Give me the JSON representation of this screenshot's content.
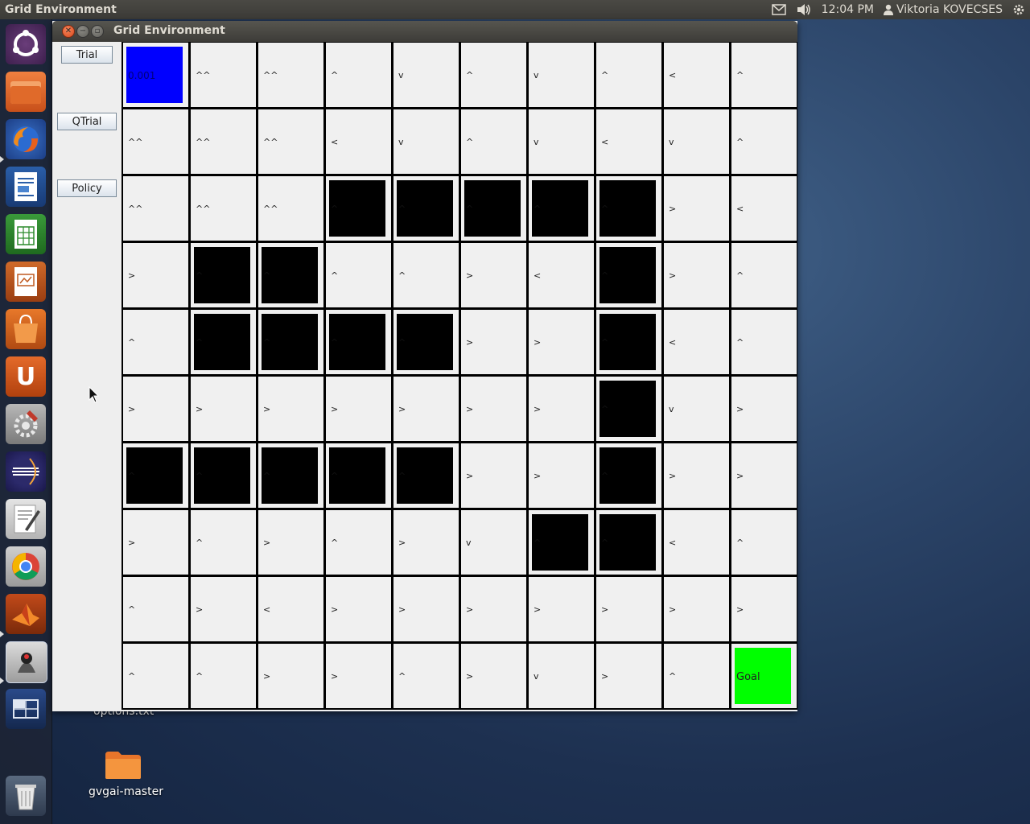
{
  "top_panel": {
    "app_title": "Grid Environment",
    "time": "12:04 PM",
    "user": "Viktoria KOVECSES"
  },
  "desktop": {
    "items": [
      {
        "label": "options.txt"
      },
      {
        "label": "gvgai-master"
      }
    ]
  },
  "launcher": {
    "items": [
      "ubuntu-dash-icon",
      "files-icon",
      "firefox-icon",
      "writer-icon",
      "calc-icon",
      "impress-icon",
      "software-center-icon",
      "ubuntu-one-icon",
      "system-settings-icon",
      "eclipse-icon",
      "text-editor-icon",
      "chrome-icon",
      "matlab-icon",
      "java-icon",
      "workspace-switcher-icon",
      "trash-icon"
    ]
  },
  "window": {
    "title": "Grid Environment",
    "buttons": {
      "trial": "Trial",
      "qtrial": "QTrial",
      "policy": "Policy"
    },
    "grid": {
      "rows": [
        [
          {
            "t": "agent",
            "v": "0.001"
          },
          {
            "t": "n",
            "v": "^^"
          },
          {
            "t": "n",
            "v": "^^"
          },
          {
            "t": "n",
            "v": "^"
          },
          {
            "t": "n",
            "v": "v"
          },
          {
            "t": "n",
            "v": "^"
          },
          {
            "t": "n",
            "v": "v"
          },
          {
            "t": "n",
            "v": "^"
          },
          {
            "t": "n",
            "v": "<"
          },
          {
            "t": "n",
            "v": "^"
          }
        ],
        [
          {
            "t": "n",
            "v": "^^"
          },
          {
            "t": "n",
            "v": "^^"
          },
          {
            "t": "n",
            "v": "^^"
          },
          {
            "t": "n",
            "v": "<"
          },
          {
            "t": "n",
            "v": "v"
          },
          {
            "t": "n",
            "v": "^"
          },
          {
            "t": "n",
            "v": "v"
          },
          {
            "t": "n",
            "v": "<"
          },
          {
            "t": "n",
            "v": "v"
          },
          {
            "t": "n",
            "v": "^"
          }
        ],
        [
          {
            "t": "n",
            "v": "^^"
          },
          {
            "t": "n",
            "v": "^^"
          },
          {
            "t": "n",
            "v": "^^"
          },
          {
            "t": "w",
            "v": "^"
          },
          {
            "t": "w",
            "v": "^"
          },
          {
            "t": "w",
            "v": "^"
          },
          {
            "t": "w",
            "v": "^"
          },
          {
            "t": "w",
            "v": "^"
          },
          {
            "t": "n",
            "v": ">"
          },
          {
            "t": "n",
            "v": "<"
          }
        ],
        [
          {
            "t": "n",
            "v": ">"
          },
          {
            "t": "w",
            "v": "^"
          },
          {
            "t": "w",
            "v": "^"
          },
          {
            "t": "n",
            "v": "^"
          },
          {
            "t": "n",
            "v": "^"
          },
          {
            "t": "n",
            "v": ">"
          },
          {
            "t": "n",
            "v": "<"
          },
          {
            "t": "w",
            "v": "^"
          },
          {
            "t": "n",
            "v": ">"
          },
          {
            "t": "n",
            "v": "^"
          }
        ],
        [
          {
            "t": "n",
            "v": "^"
          },
          {
            "t": "w",
            "v": "^"
          },
          {
            "t": "w",
            "v": "^"
          },
          {
            "t": "w",
            "v": "^"
          },
          {
            "t": "w",
            "v": "^"
          },
          {
            "t": "n",
            "v": ">"
          },
          {
            "t": "n",
            "v": ">"
          },
          {
            "t": "w",
            "v": "^"
          },
          {
            "t": "n",
            "v": "<"
          },
          {
            "t": "n",
            "v": "^"
          }
        ],
        [
          {
            "t": "n",
            "v": ">"
          },
          {
            "t": "n",
            "v": ">"
          },
          {
            "t": "n",
            "v": ">"
          },
          {
            "t": "n",
            "v": ">"
          },
          {
            "t": "n",
            "v": ">"
          },
          {
            "t": "n",
            "v": ">"
          },
          {
            "t": "n",
            "v": ">"
          },
          {
            "t": "w",
            "v": "^"
          },
          {
            "t": "n",
            "v": "v"
          },
          {
            "t": "n",
            "v": ">"
          }
        ],
        [
          {
            "t": "w",
            "v": "^"
          },
          {
            "t": "w",
            "v": "^"
          },
          {
            "t": "w",
            "v": "^"
          },
          {
            "t": "w",
            "v": "^"
          },
          {
            "t": "w",
            "v": "^"
          },
          {
            "t": "n",
            "v": ">"
          },
          {
            "t": "n",
            "v": ">"
          },
          {
            "t": "w",
            "v": "^"
          },
          {
            "t": "n",
            "v": ">"
          },
          {
            "t": "n",
            "v": ">"
          }
        ],
        [
          {
            "t": "n",
            "v": ">"
          },
          {
            "t": "n",
            "v": "^"
          },
          {
            "t": "n",
            "v": ">"
          },
          {
            "t": "n",
            "v": "^"
          },
          {
            "t": "n",
            "v": ">"
          },
          {
            "t": "n",
            "v": "v"
          },
          {
            "t": "w",
            "v": "^"
          },
          {
            "t": "w",
            "v": "^"
          },
          {
            "t": "n",
            "v": "<"
          },
          {
            "t": "n",
            "v": "^"
          }
        ],
        [
          {
            "t": "n",
            "v": "^"
          },
          {
            "t": "n",
            "v": ">"
          },
          {
            "t": "n",
            "v": "<"
          },
          {
            "t": "n",
            "v": ">"
          },
          {
            "t": "n",
            "v": ">"
          },
          {
            "t": "n",
            "v": ">"
          },
          {
            "t": "n",
            "v": ">"
          },
          {
            "t": "n",
            "v": ">"
          },
          {
            "t": "n",
            "v": ">"
          },
          {
            "t": "n",
            "v": ">"
          }
        ],
        [
          {
            "t": "n",
            "v": "^"
          },
          {
            "t": "n",
            "v": "^"
          },
          {
            "t": "n",
            "v": ">"
          },
          {
            "t": "n",
            "v": ">"
          },
          {
            "t": "n",
            "v": "^"
          },
          {
            "t": "n",
            "v": ">"
          },
          {
            "t": "n",
            "v": "v"
          },
          {
            "t": "n",
            "v": ">"
          },
          {
            "t": "n",
            "v": "^"
          },
          {
            "t": "goal",
            "v": "Goal"
          }
        ]
      ]
    }
  },
  "colors": {
    "agent": "#0000ff",
    "goal": "#00ff00",
    "wall": "#000000",
    "cell": "#f0f0f0"
  }
}
